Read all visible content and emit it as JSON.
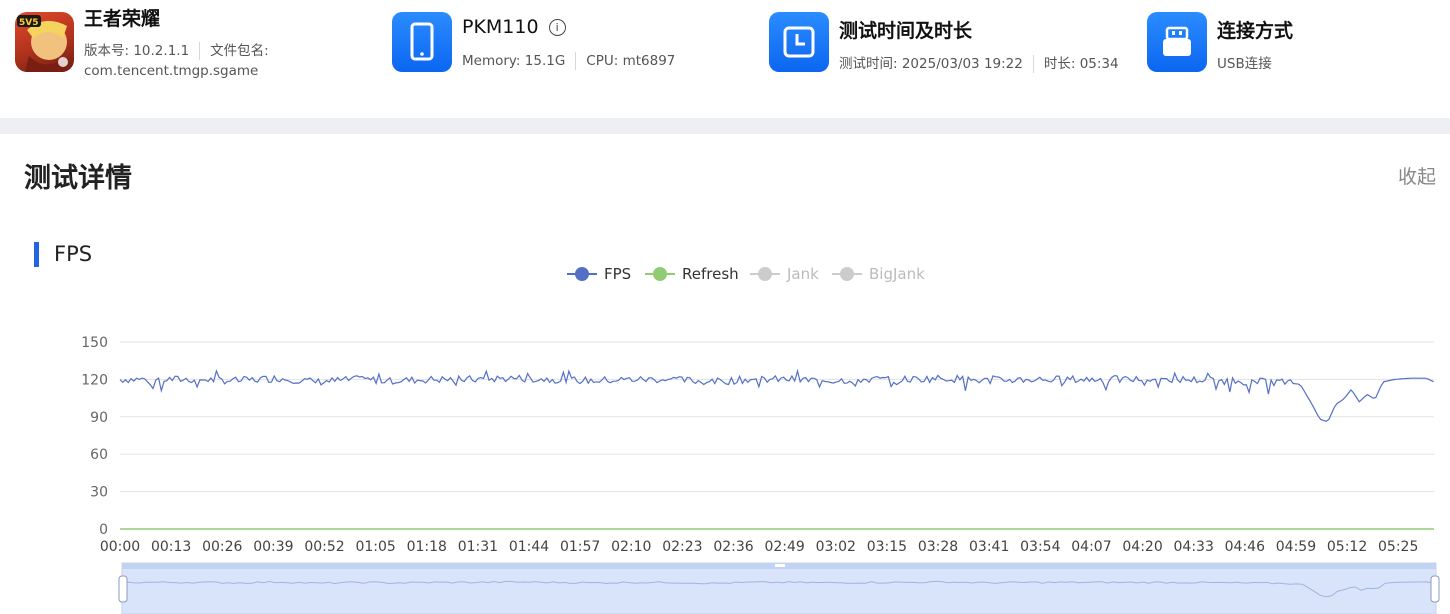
{
  "app": {
    "name": "王者荣耀",
    "version": "版本号: 10.2.1.1",
    "package_label": "文件包名:",
    "package": "com.tencent.tmgp.sgame"
  },
  "device": {
    "model": "PKM110",
    "memory": "Memory: 15.1G",
    "cpu": "CPU: mt6897"
  },
  "test_time": {
    "title": "测试时间及时长",
    "time": "测试时间: 2025/03/03 19:22",
    "duration": "时长: 05:34"
  },
  "connection": {
    "title": "连接方式",
    "method": "USB连接"
  },
  "details": {
    "title": "测试详情",
    "collapse_label": "收起"
  },
  "fps_section": {
    "title": "FPS"
  },
  "colors": {
    "fps": "#5470c6",
    "refresh": "#91cc75",
    "disabled": "#cccccc",
    "accent": "#1f66e0"
  },
  "chart_data": {
    "type": "line",
    "legend": [
      {
        "name": "FPS",
        "active": true
      },
      {
        "name": "Refresh",
        "active": true
      },
      {
        "name": "Jank",
        "active": false
      },
      {
        "name": "BigJank",
        "active": false
      }
    ],
    "x_tick_labels": [
      "00:00",
      "00:13",
      "00:26",
      "00:39",
      "00:52",
      "01:05",
      "01:18",
      "01:31",
      "01:44",
      "01:57",
      "02:10",
      "02:23",
      "02:36",
      "02:49",
      "03:02",
      "03:15",
      "03:28",
      "03:41",
      "03:54",
      "04:07",
      "04:20",
      "04:33",
      "04:46",
      "04:59",
      "05:12",
      "05:25"
    ],
    "y_ticks": [
      0,
      30,
      60,
      90,
      120,
      150
    ],
    "ylim": [
      0,
      150
    ],
    "x_range_seconds": [
      0,
      334
    ],
    "grid": true,
    "series": [
      {
        "name": "FPS",
        "points": [
          [
            0,
            120
          ],
          [
            10,
            120
          ],
          [
            20,
            120
          ],
          [
            30,
            119
          ],
          [
            40,
            121
          ],
          [
            50,
            118
          ],
          [
            60,
            120
          ],
          [
            70,
            119
          ],
          [
            80,
            120
          ],
          [
            90,
            120
          ],
          [
            100,
            121
          ],
          [
            110,
            120
          ],
          [
            120,
            119
          ],
          [
            130,
            120
          ],
          [
            140,
            120
          ],
          [
            150,
            118
          ],
          [
            160,
            120
          ],
          [
            170,
            120
          ],
          [
            180,
            119
          ],
          [
            190,
            120
          ],
          [
            200,
            120
          ],
          [
            210,
            121
          ],
          [
            220,
            119
          ],
          [
            230,
            120
          ],
          [
            240,
            120
          ],
          [
            250,
            120
          ],
          [
            260,
            120
          ],
          [
            270,
            120
          ],
          [
            280,
            119
          ],
          [
            290,
            118
          ],
          [
            295,
            118
          ],
          [
            300,
            116
          ],
          [
            303,
            100
          ],
          [
            305,
            88
          ],
          [
            307,
            86
          ],
          [
            309,
            100
          ],
          [
            311,
            104
          ],
          [
            313,
            112
          ],
          [
            315,
            102
          ],
          [
            317,
            108
          ],
          [
            319,
            104
          ],
          [
            321,
            118
          ],
          [
            324,
            120
          ],
          [
            328,
            121
          ],
          [
            332,
            121
          ],
          [
            334,
            118
          ]
        ]
      },
      {
        "name": "Refresh",
        "points": [
          [
            0,
            0
          ],
          [
            334,
            0
          ]
        ]
      }
    ]
  }
}
